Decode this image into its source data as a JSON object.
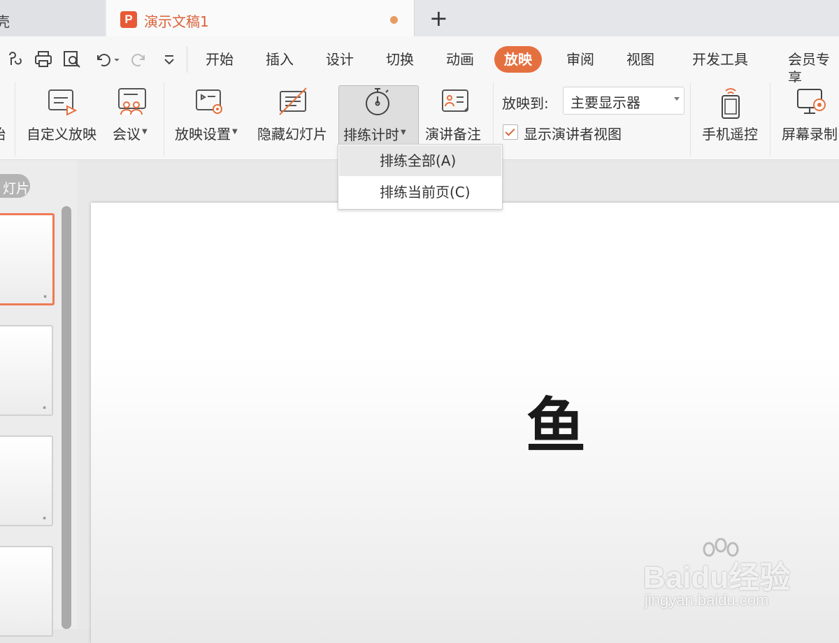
{
  "tabs": {
    "left_label": "壳",
    "active_icon": "P",
    "active_title": "演示文稿1",
    "new_tab": "+"
  },
  "quick_access": [
    "share-icon",
    "print-icon",
    "print-preview-icon",
    "undo-icon",
    "redo-icon",
    "customize-icon"
  ],
  "menu": {
    "items": [
      "开始",
      "插入",
      "设计",
      "切换",
      "动画",
      "放映",
      "审阅",
      "视图",
      "开发工具",
      "会员专享"
    ],
    "active": "放映"
  },
  "ribbon": {
    "left_clip": "始",
    "custom_show": "自定义放映",
    "meeting": "会议",
    "show_settings": "放映设置",
    "hide_slide": "隐藏幻灯片",
    "rehearse_timing": "排练计时",
    "speaker_notes": "演讲备注",
    "show_on_label": "放映到:",
    "show_on_value": "主要显示器",
    "presenter_view": "显示演讲者视图",
    "presenter_view_checked": true,
    "phone_remote": "手机遥控",
    "screen_record": "屏幕录制"
  },
  "dropdown": {
    "items": [
      "排练全部(A)",
      "排练当前页(C)"
    ],
    "highlighted": 0
  },
  "left_pane": {
    "label": "灯片"
  },
  "slide": {
    "text": "鱼"
  },
  "watermark": {
    "main": "Baidu经验",
    "sub": "jingyan.baidu.com"
  },
  "colors": {
    "accent": "#e5703f",
    "tab_title": "#d9623a",
    "selected_thumb": "#ee7a56"
  }
}
